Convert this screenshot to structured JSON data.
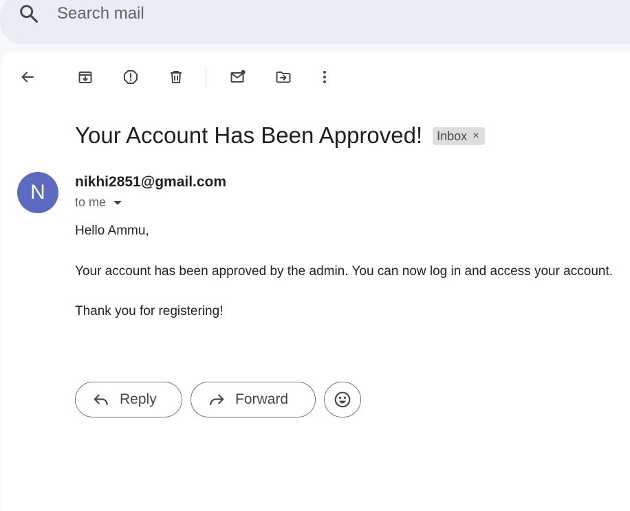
{
  "search": {
    "placeholder": "Search mail",
    "icon": "search-icon"
  },
  "toolbar": {
    "buttons": [
      {
        "name": "back",
        "icon": "arrow-left-icon"
      },
      {
        "name": "archive",
        "icon": "archive-icon"
      },
      {
        "name": "report-spam",
        "icon": "report-icon"
      },
      {
        "name": "delete",
        "icon": "trash-icon"
      },
      {
        "name": "mark-unread",
        "icon": "mark-unread-icon"
      },
      {
        "name": "move-to",
        "icon": "move-to-folder-icon"
      },
      {
        "name": "more",
        "icon": "more-vert-icon"
      }
    ]
  },
  "message": {
    "subject": "Your Account Has Been Approved!",
    "label": "Inbox",
    "label_close": "×",
    "avatar_letter": "N",
    "avatar_color": "#5c6bc0",
    "sender": "nikhi2851@gmail.com",
    "recipient": "to me",
    "body": [
      "Hello Ammu,",
      "Your account has been approved by the admin. You can now log in and access your account.",
      "Thank you for registering!"
    ]
  },
  "actions": {
    "reply_label": "Reply",
    "forward_label": "Forward",
    "emoji_icon": "emoji-icon"
  },
  "colors": {
    "background": "#f6f8fc",
    "search_bg": "#e9eef6",
    "text": "#1f1f1f",
    "muted": "#5f6368"
  }
}
